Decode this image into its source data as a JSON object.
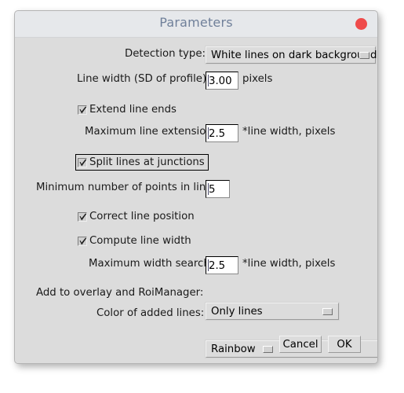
{
  "window": {
    "title": "Parameters",
    "close_icon": "close-circle-icon",
    "accent_close_color": "#ef4b4b",
    "title_color": "#70809a"
  },
  "fields": {
    "detection_type": {
      "label": "Detection type:",
      "value": "White lines on dark background",
      "arrow_icon": "dropdown-arrow-icon"
    },
    "line_width": {
      "label": "Line width (SD of profile)",
      "value": "3.00",
      "unit": "pixels"
    },
    "extend_line_ends": {
      "label": "Extend line ends",
      "checked": true
    },
    "max_line_extension": {
      "label": "Maximum line extension",
      "value": "2.5",
      "unit": "*line width, pixels"
    },
    "split_lines": {
      "label": "Split lines at junctions",
      "checked": true,
      "focused": true
    },
    "min_points": {
      "label": "Minimum number of points in line",
      "value": "5"
    },
    "correct_line_position": {
      "label": "Correct line position",
      "checked": true
    },
    "compute_line_width": {
      "label": "Compute line width",
      "checked": true
    },
    "max_width_search": {
      "label": "Maximum width search",
      "value": "2.5",
      "unit": "*line width, pixels"
    },
    "add_to_overlay": {
      "label": "Add to overlay and RoiManager:",
      "value": "Only lines",
      "arrow_icon": "dropdown-arrow-icon"
    },
    "color_of_lines": {
      "label": "Color of added lines:",
      "value": "Rainbow",
      "arrow_icon": "dropdown-arrow-icon"
    }
  },
  "buttons": {
    "cancel": "Cancel",
    "ok": "OK"
  }
}
